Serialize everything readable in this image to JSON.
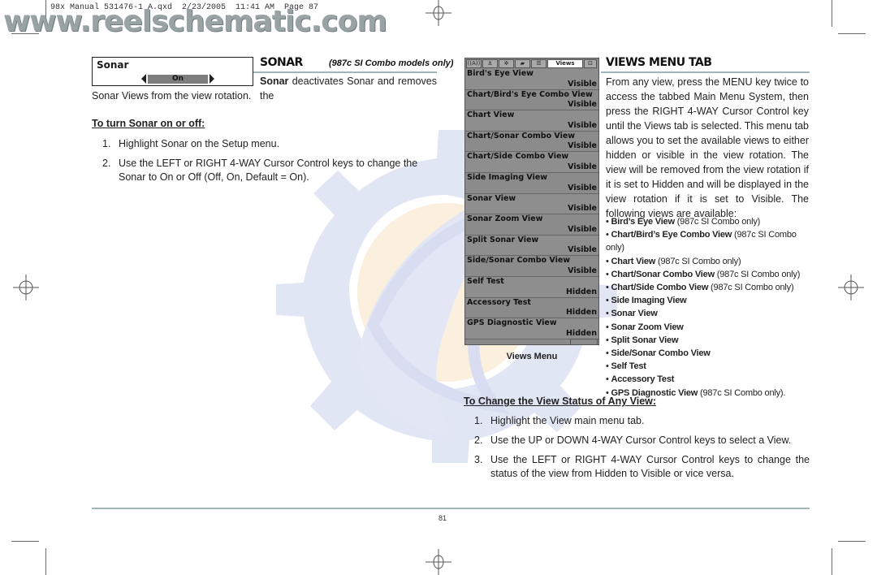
{
  "header": {
    "slug": "98x Manual 531476-1 A.qxd  2/23/2005  11:41 AM  Page 87",
    "watermark": "www.reelschematic.com"
  },
  "sonar_section": {
    "setting_widget": {
      "title": "Sonar",
      "value": "On",
      "left_arrow": "arrow-left-icon",
      "right_arrow": "arrow-right-icon"
    },
    "title": "SONAR",
    "subtitle": "(987c SI Combo models only)",
    "intro_bold": "Sonar",
    "intro_rest_line1": " deactivates Sonar and removes the",
    "intro_line2": "Sonar Views from the view rotation.",
    "procedure_heading": "To turn Sonar on or off:",
    "steps": [
      {
        "num": "1.",
        "text": "Highlight Sonar on the Setup menu."
      },
      {
        "num": "2.",
        "text": "Use the LEFT or RIGHT 4-WAY Cursor Control keys to change the Sonar to On or Off (Off, On, Default = On)."
      }
    ]
  },
  "views_screen": {
    "tabs": [
      {
        "icon": "sonar-tab-icon",
        "label": "((A))"
      },
      {
        "icon": "navigation-tab-icon",
        "label": "⚓"
      },
      {
        "icon": "alarms-tab-icon",
        "label": "✲"
      },
      {
        "icon": "chart-tab-icon",
        "label": "▰"
      },
      {
        "icon": "setup-tab-icon",
        "label": "☰"
      },
      {
        "icon": "views-tab-icon",
        "label": "Views",
        "active": true
      },
      {
        "icon": "accessories-tab-icon",
        "label": "⊡"
      }
    ],
    "rows": [
      {
        "name": "Bird's Eye View",
        "status": "Visible"
      },
      {
        "name": "Chart/Bird's Eye Combo View",
        "status": "Visible"
      },
      {
        "name": "Chart View",
        "status": "Visible"
      },
      {
        "name": "Chart/Sonar Combo View",
        "status": "Visible"
      },
      {
        "name": "Chart/Side Combo View",
        "status": "Visible"
      },
      {
        "name": "Side Imaging View",
        "status": "Visible"
      },
      {
        "name": "Sonar View",
        "status": "Visible"
      },
      {
        "name": "Sonar Zoom View",
        "status": "Visible"
      },
      {
        "name": "Split Sonar View",
        "status": "Visible"
      },
      {
        "name": "Side/Sonar Combo View",
        "status": "Visible"
      },
      {
        "name": "Self Test",
        "status": "Hidden"
      },
      {
        "name": "Accessory Test",
        "status": "Hidden"
      },
      {
        "name": "GPS Diagnostic View",
        "status": "Hidden"
      }
    ],
    "caption": "Views Menu"
  },
  "views_section": {
    "title": "VIEWS MENU TAB",
    "paragraph": "From any view, press the MENU key twice to access the tabbed Main Menu System, then press the RIGHT 4-WAY Cursor Control key until the Views tab is selected. This menu tab allows you to set the available views to either hidden or visible in the view rotation. The view will be removed from the view rotation if it is set to Hidden and will be displayed in the view rotation if it is set to Visible. The following views are available:",
    "list": [
      {
        "bold": "Bird’s Eye View",
        "note": " (987c SI Combo only)"
      },
      {
        "bold": "Chart/Bird’s Eye Combo View",
        "note": " (987c SI Combo only)"
      },
      {
        "bold": "Chart View",
        "note": " (987c SI Combo only)"
      },
      {
        "bold": "Chart/Sonar Combo View",
        "note": " (987c SI Combo only)"
      },
      {
        "bold": "Chart/Side Combo View",
        "note": " (987c SI Combo only)"
      },
      {
        "bold": "Side Imaging View",
        "note": ""
      },
      {
        "bold": "Sonar View",
        "note": ""
      },
      {
        "bold": "Sonar Zoom View",
        "note": ""
      },
      {
        "bold": "Split Sonar View",
        "note": ""
      },
      {
        "bold": "Side/Sonar Combo View",
        "note": ""
      },
      {
        "bold": "Self Test",
        "note": ""
      },
      {
        "bold": "Accessory Test",
        "note": ""
      },
      {
        "bold": "GPS Diagnostic View",
        "note": " (987c SI Combo only)."
      }
    ],
    "procedure_heading": "To Change the View Status of Any View:",
    "steps": [
      {
        "num": "1.",
        "text": " Highlight the View main menu tab."
      },
      {
        "num": "2.",
        "text": "Use the UP or DOWN 4-WAY Cursor Control keys to select a View."
      },
      {
        "num": "3.",
        "text": "Use the LEFT or RIGHT 4-WAY Cursor Control keys to change the status of the view from Hidden to Visible or vice versa."
      }
    ]
  },
  "footer": {
    "page_number": "81"
  }
}
